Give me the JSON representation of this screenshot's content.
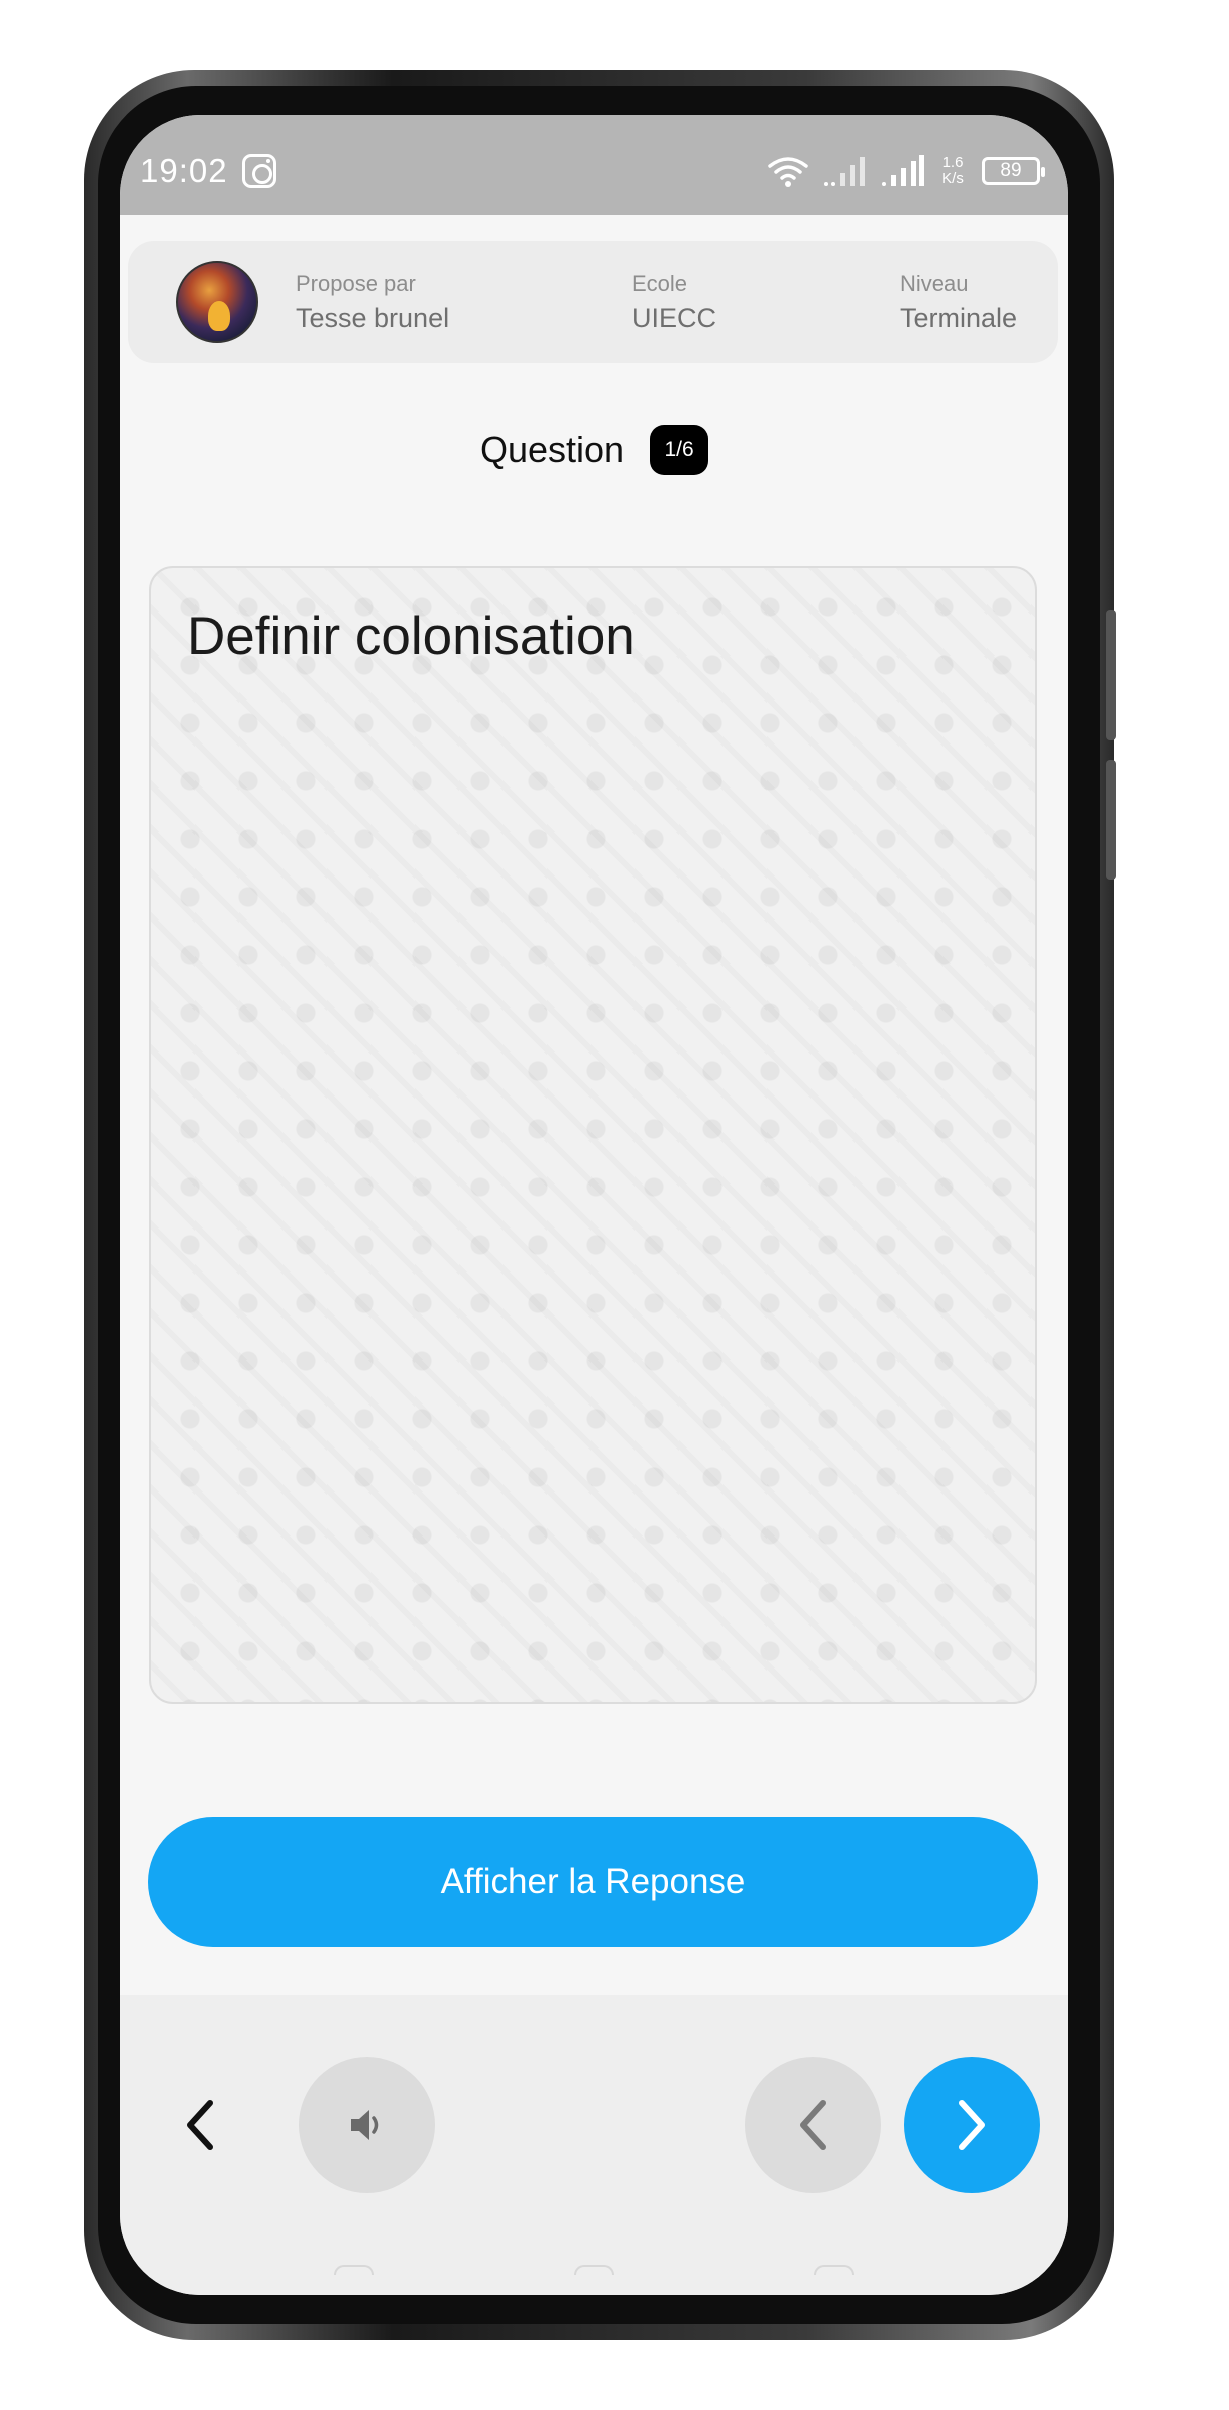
{
  "status_bar": {
    "time": "19:02",
    "speed_value": "1.6",
    "speed_unit": "K/s",
    "battery": "89",
    "icons": [
      "instagram-icon",
      "wifi-icon",
      "signal-icon",
      "signal-icon",
      "battery-icon"
    ]
  },
  "author": {
    "proposed_by_label": "Propose par",
    "proposed_by_value": "Tesse brunel",
    "school_label": "Ecole",
    "school_value": "UIECC",
    "level_label": "Niveau",
    "level_value": "Terminale"
  },
  "question": {
    "label": "Question",
    "counter": "1/6",
    "text": "Definir colonisation"
  },
  "actions": {
    "show_answer_label": "Afficher la Reponse"
  },
  "controls": {
    "back_icon": "chevron-left-icon",
    "sound_icon": "speaker-icon",
    "prev_icon": "chevron-left-icon",
    "next_icon": "chevron-right-icon"
  },
  "colors": {
    "accent": "#14a6f4",
    "status_bar": "#b5b5b5",
    "badge": "#000000",
    "background": "#f6f6f6"
  }
}
